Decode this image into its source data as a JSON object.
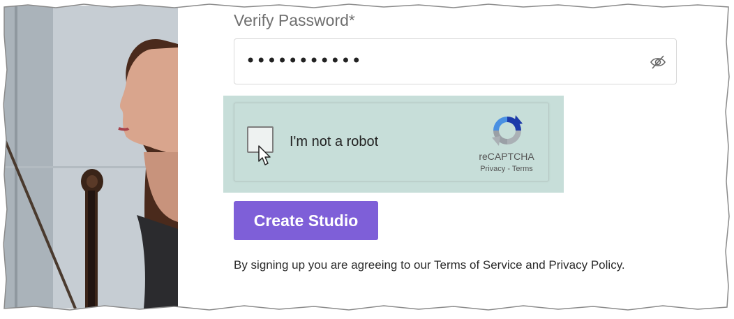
{
  "form": {
    "verify_label": "Verify Password*",
    "password_value": "•••••••••••",
    "toggle_icon": "eye-off-icon"
  },
  "captcha": {
    "label": "I'm not a robot",
    "brand": "reCAPTCHA",
    "privacy": "Privacy",
    "separator": "-",
    "terms": "Terms",
    "highlight_color": "#c7ded9"
  },
  "actions": {
    "create_label": "Create Studio",
    "button_color": "#7e5fd8"
  },
  "legal": {
    "text": "By signing up you are agreeing to our Terms of Service and Privacy Policy."
  }
}
